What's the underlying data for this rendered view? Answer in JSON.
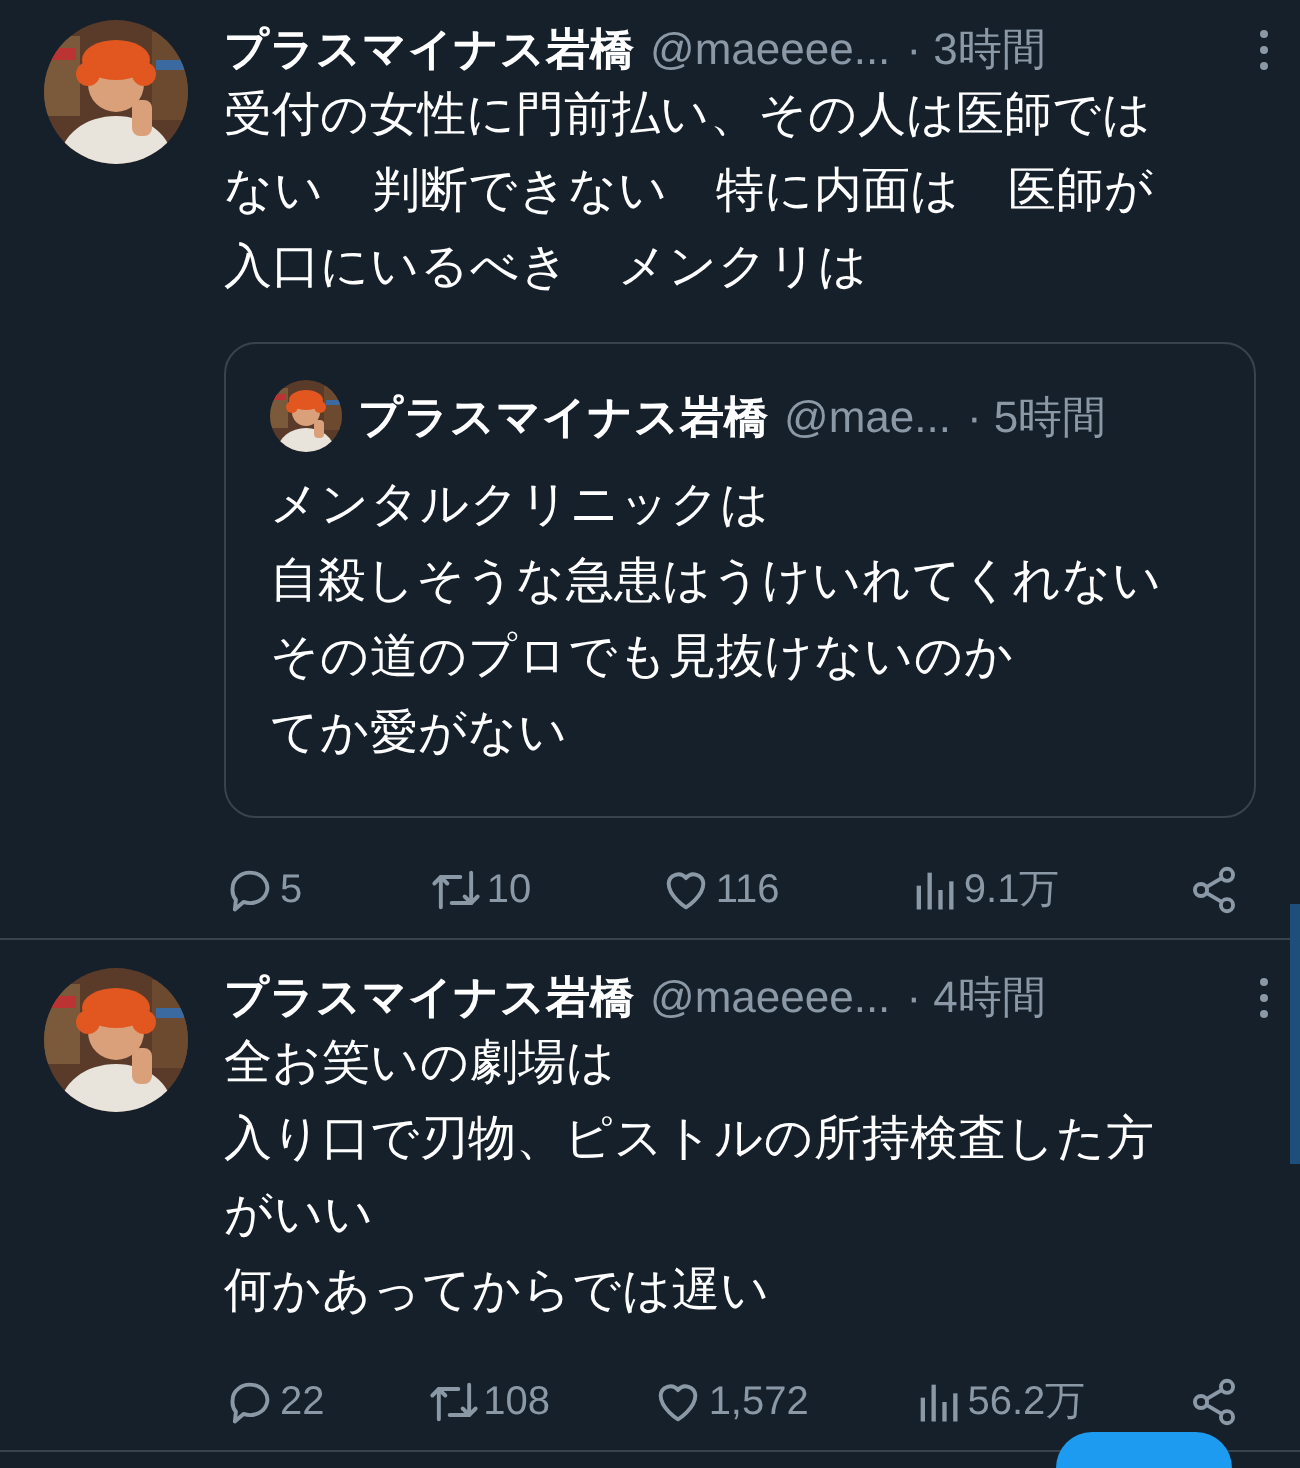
{
  "tweets": [
    {
      "avatar": {
        "kind": "picture"
      },
      "name": "プラスマイナス岩橋",
      "handle": "@maeeee...",
      "time": "· 3時間",
      "lines": [
        "受付の女性に門前払い、その人は医師では",
        "ない　判断できない　特に内面は　医師が",
        "入口にいるべき　メンクリは"
      ],
      "quote": {
        "avatar": {
          "kind": "picture"
        },
        "name": "プラスマイナス岩橋",
        "handle": "@mae...",
        "time": "· 5時間",
        "lines": [
          "メンタルクリニックは",
          "自殺しそうな急患はうけいれてくれない",
          "その道のプロでも見抜けないのか",
          "てか愛がない"
        ]
      },
      "actions": {
        "replies": "5",
        "retweets": "10",
        "likes": "116",
        "views": "9.1万"
      }
    },
    {
      "avatar": {
        "kind": "picture"
      },
      "name": "プラスマイナス岩橋",
      "handle": "@maeeee...",
      "time": "· 4時間",
      "lines": [
        "全お笑いの劇場は",
        "入り口で刃物、ピストルの所持検査した方",
        "がいい",
        "何かあってからでは遅い"
      ],
      "actions": {
        "replies": "22",
        "retweets": "108",
        "likes": "1,572",
        "views": "56.2万"
      }
    }
  ]
}
